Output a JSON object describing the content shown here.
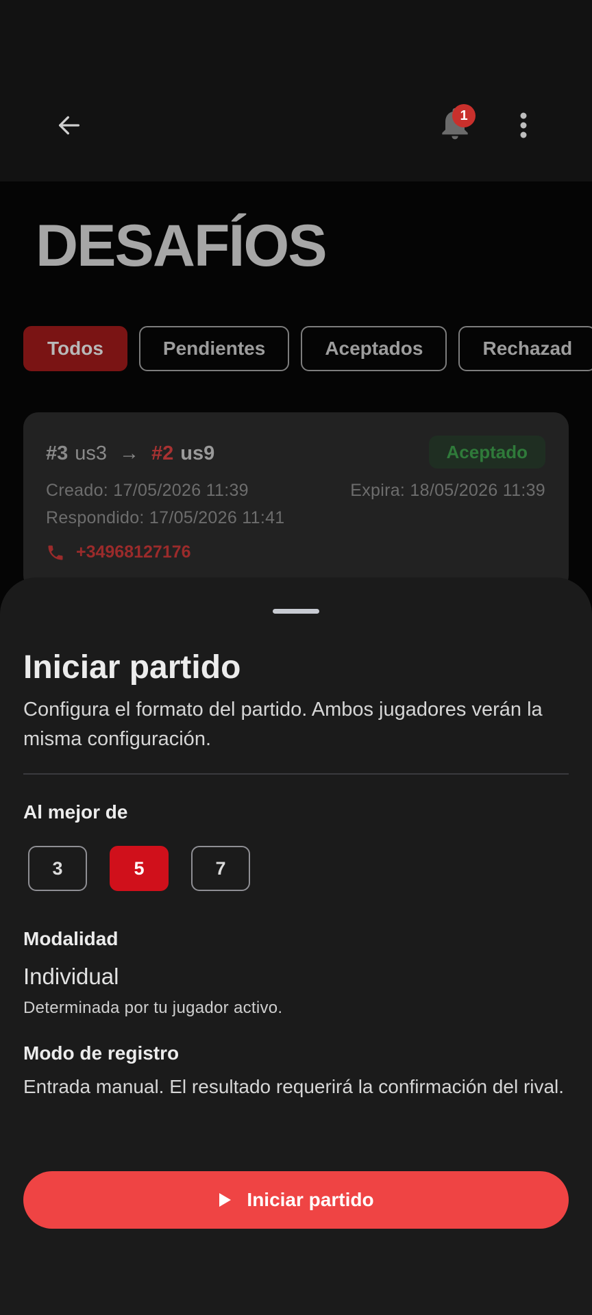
{
  "header": {
    "notification_count": "1"
  },
  "page": {
    "title": "DESAFÍOS"
  },
  "filters": [
    {
      "label": "Todos",
      "active": true
    },
    {
      "label": "Pendientes",
      "active": false
    },
    {
      "label": "Aceptados",
      "active": false
    },
    {
      "label": "Rechazad",
      "active": false
    }
  ],
  "challenge": {
    "challenger_rank": "#3",
    "challenger_name": "us3",
    "arrow": "→",
    "opponent_rank": "#2",
    "opponent_name": "us9",
    "status": "Aceptado",
    "created": "Creado: 17/05/2026 11:39",
    "expires": "Expira: 18/05/2026 11:39",
    "responded": "Respondido: 17/05/2026 11:41",
    "phone": "+34968127176"
  },
  "sheet": {
    "title": "Iniciar partido",
    "description": "Configura el formato del partido. Ambos jugadores verán la misma configuración.",
    "best_of_label": "Al mejor de",
    "best_of_options": [
      "3",
      "5",
      "7"
    ],
    "best_of_selected": "5",
    "modality_label": "Modalidad",
    "modality_value": "Individual",
    "modality_note": "Determinada por tu jugador activo.",
    "register_label": "Modo de registro",
    "register_value": "Entrada manual. El resultado requerirá la confirmación del rival.",
    "start_button": "Iniciar partido"
  },
  "colors": {
    "accent_red": "#ef4444",
    "selected_red": "#d0101b",
    "status_green": "#2f7a3a"
  }
}
